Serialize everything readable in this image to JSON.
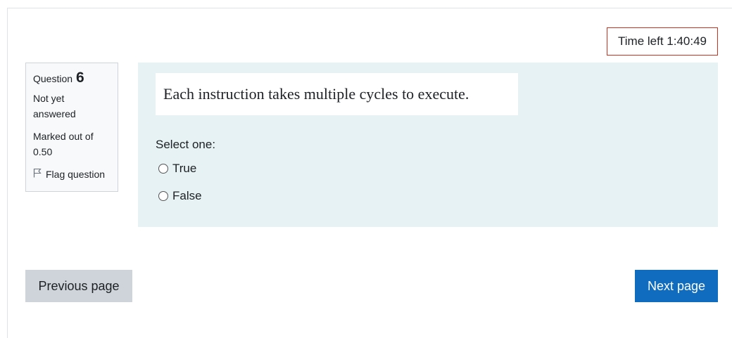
{
  "timer": {
    "label": "Time left 1:40:49"
  },
  "question_info": {
    "question_label": "Question",
    "question_number": "6",
    "state_line1": "Not yet",
    "state_line2": "answered",
    "grade_line1": "Marked out of",
    "grade_line2": "0.50",
    "flag_label": "Flag question"
  },
  "question": {
    "text": "Each instruction takes multiple cycles to execute.",
    "prompt": "Select one:",
    "options": [
      {
        "label": "True",
        "selected": false
      },
      {
        "label": "False",
        "selected": false
      }
    ]
  },
  "navigation": {
    "previous_label": "Previous page",
    "next_label": "Next page"
  },
  "colors": {
    "timer_border": "#ca3120",
    "content_bg": "#e7f2f5",
    "next_button_bg": "#0f6cbf",
    "prev_button_bg": "#ced4da"
  }
}
